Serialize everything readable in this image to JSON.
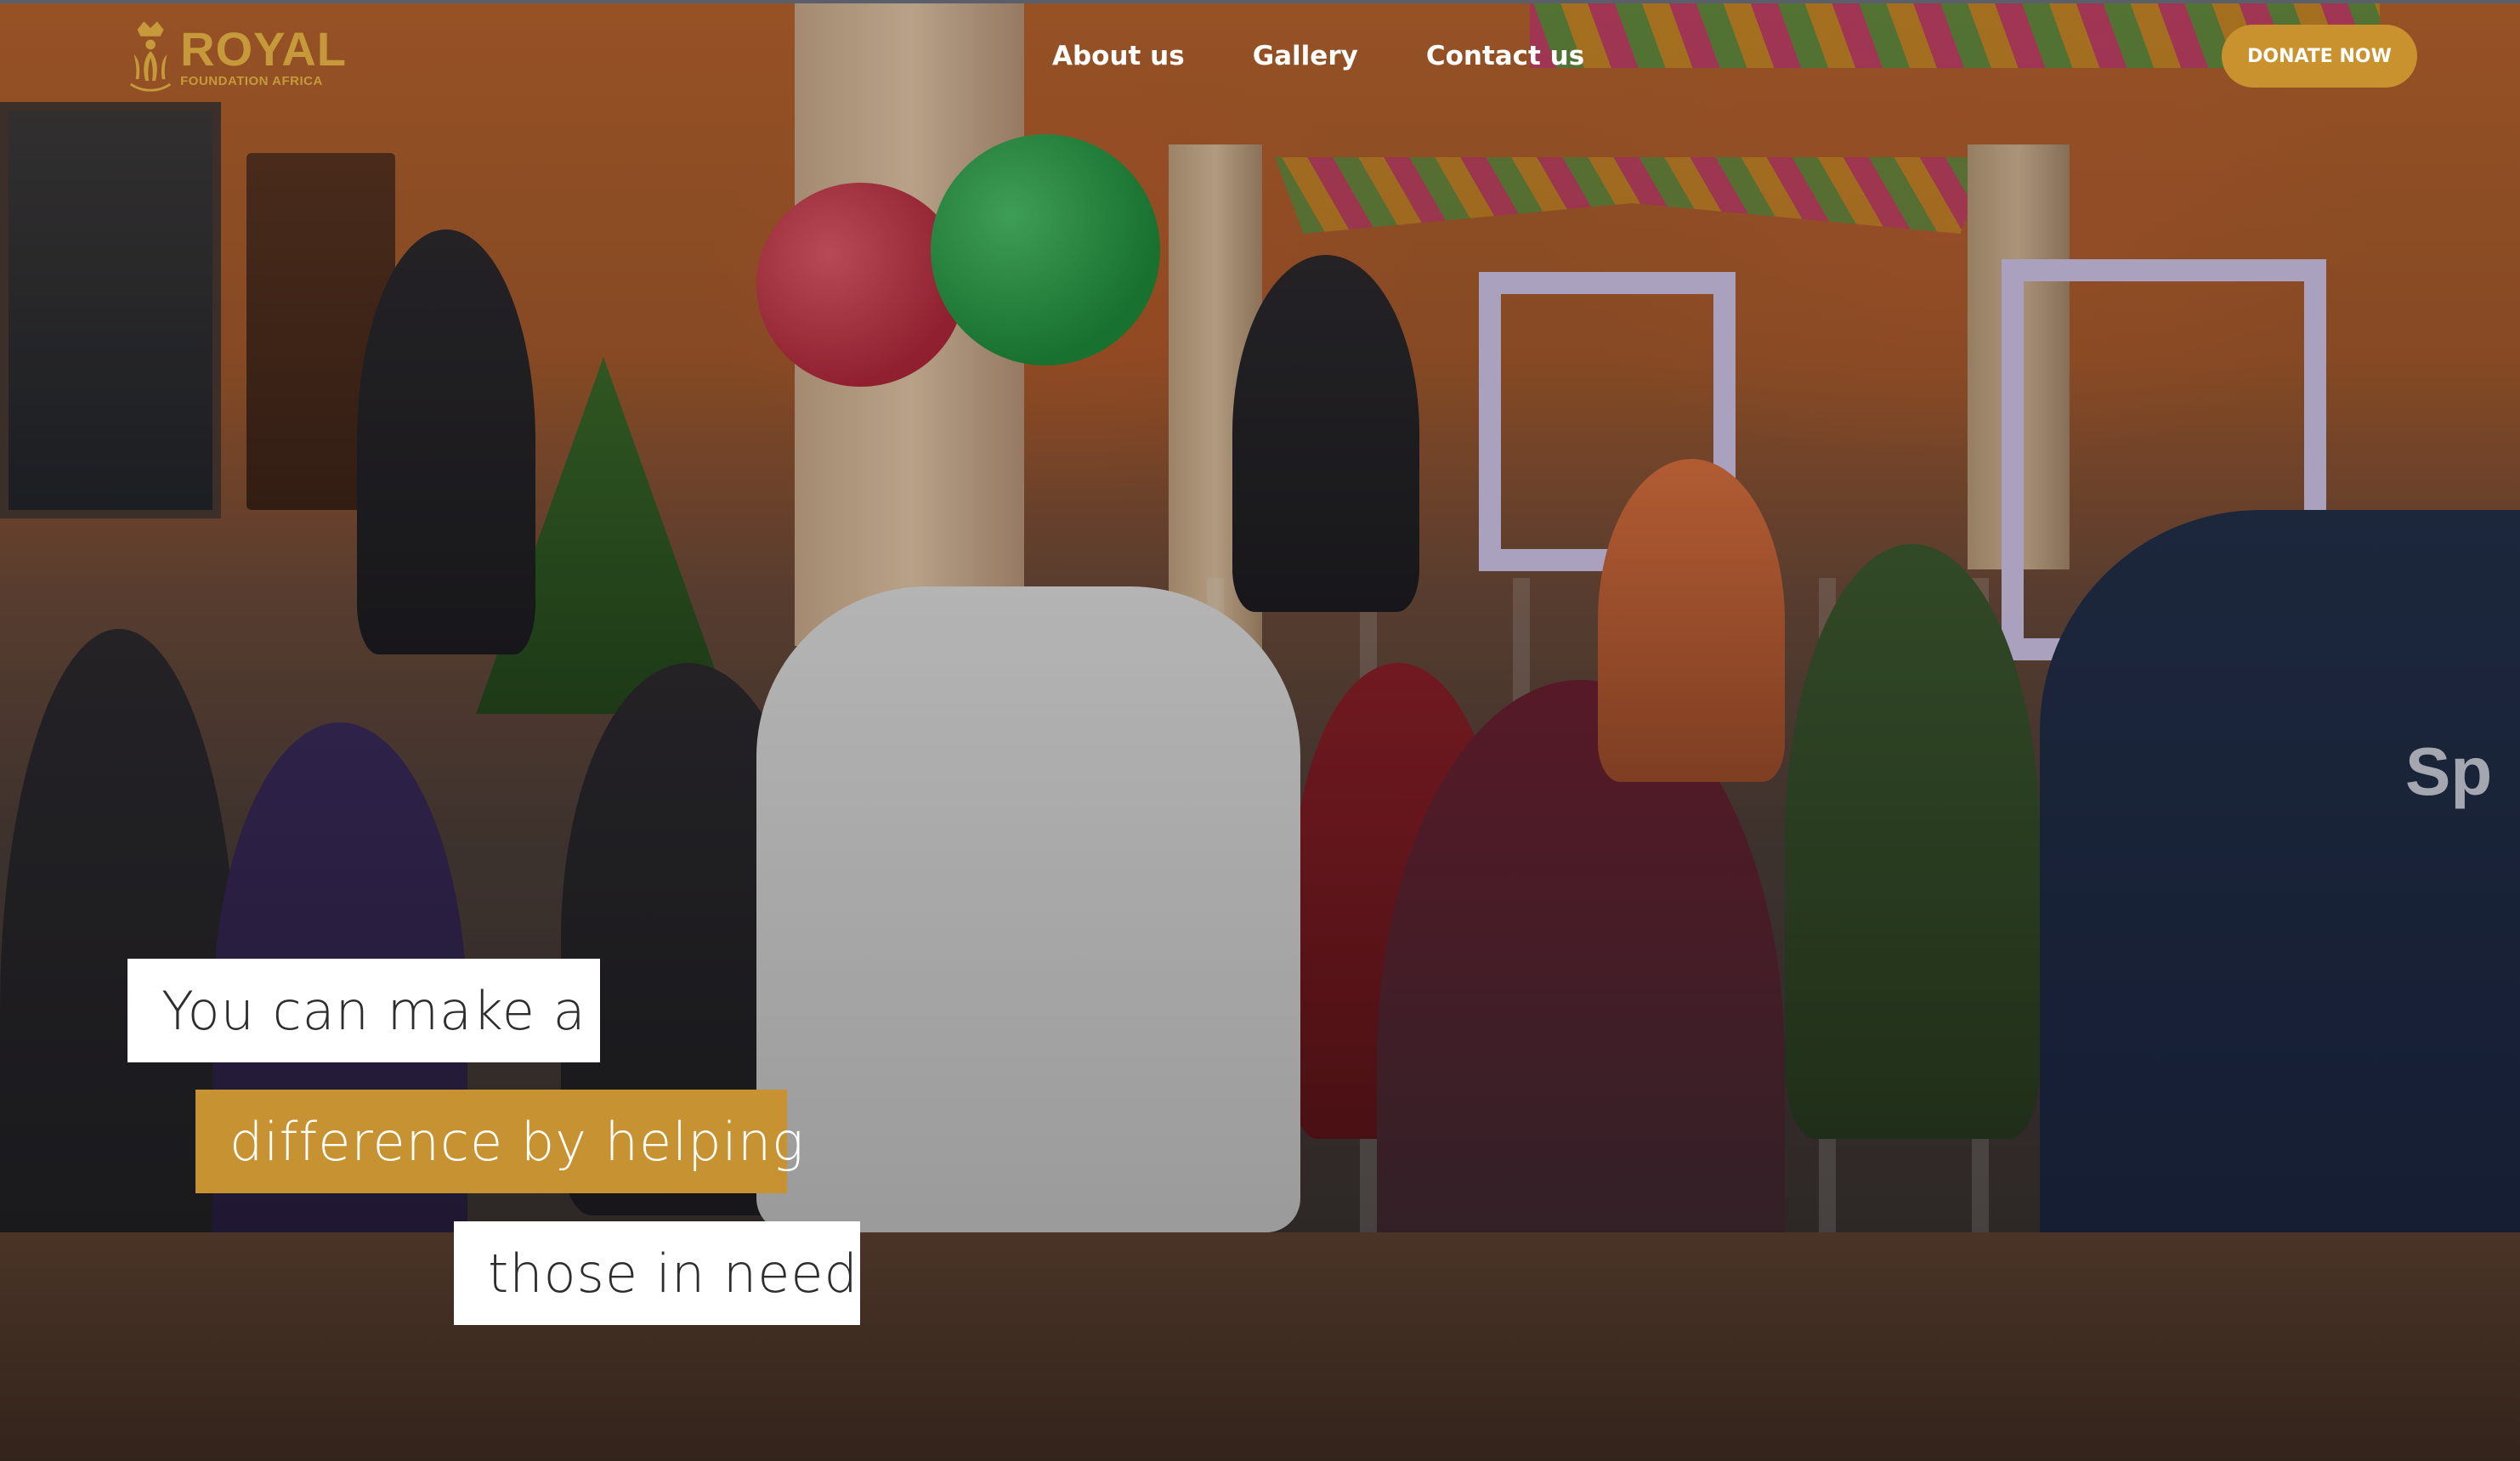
{
  "brand": {
    "name": "ROYAL",
    "tagline": "FOUNDATION AFRICA",
    "color": "#c69a3a"
  },
  "nav": {
    "items": [
      {
        "label": "About us"
      },
      {
        "label": "Gallery"
      },
      {
        "label": "Contact us"
      }
    ]
  },
  "donate": {
    "label": "DONATE NOW",
    "color": "#c9922e"
  },
  "hero": {
    "lines": [
      "You can make a",
      "difference by helping",
      "those in need"
    ],
    "shirt_text": "Sp"
  }
}
